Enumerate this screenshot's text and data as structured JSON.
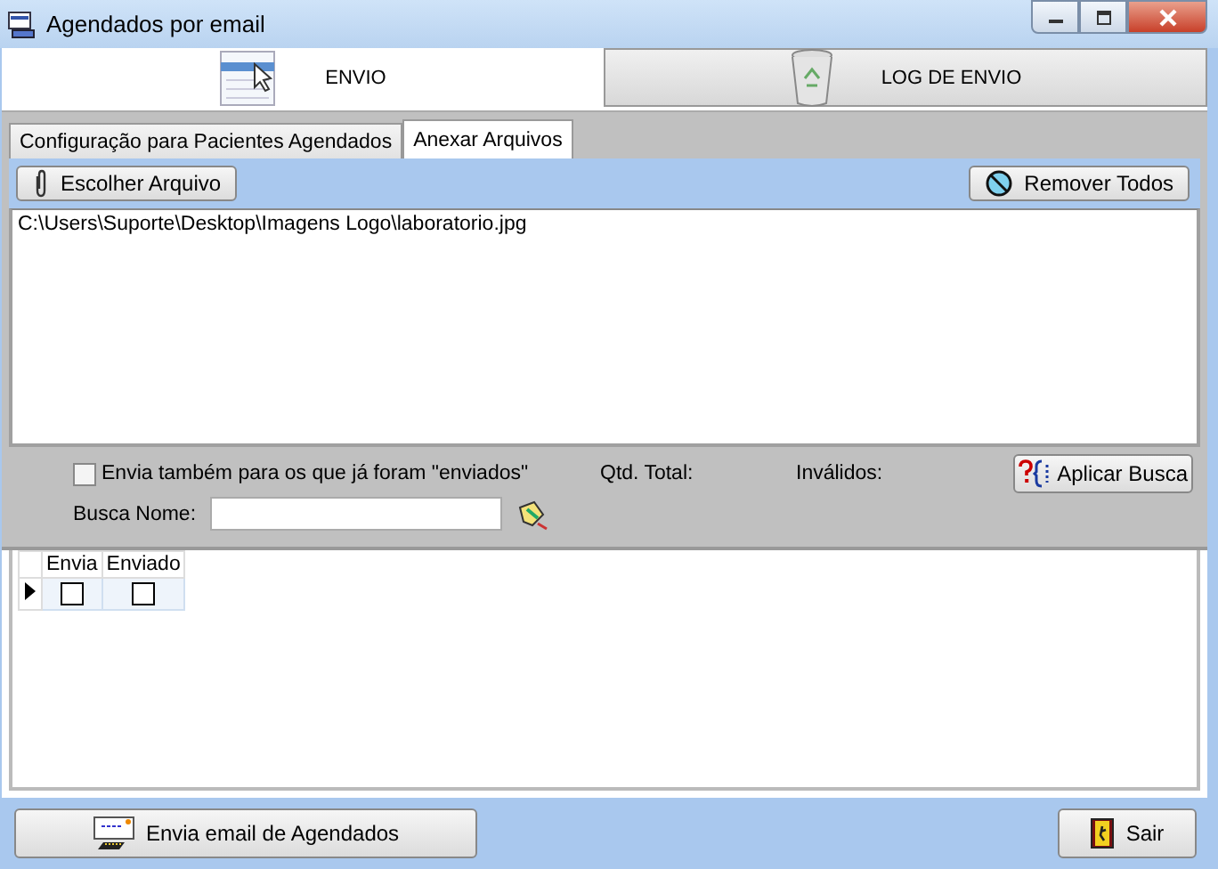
{
  "window": {
    "title": "Agendados por email"
  },
  "main_tabs": [
    {
      "label": "ENVIO",
      "selected": true,
      "kind": "form"
    },
    {
      "label": "LOG DE ENVIO",
      "selected": false,
      "kind": "trash"
    }
  ],
  "sub_tabs": [
    {
      "label": "Configuração para Pacientes Agendados",
      "selected": false
    },
    {
      "label": "Anexar Arquivos",
      "selected": true
    }
  ],
  "toolbar": {
    "choose_button": "Escolher Arquivo",
    "remove_button": "Remover Todos"
  },
  "files": [
    "C:\\Users\\Suporte\\Desktop\\Imagens Logo\\laboratorio.jpg"
  ],
  "filter": {
    "resend": {
      "label": "Envia também para os que já foram \"enviados\"",
      "checked": false
    },
    "total_label": "Qtd. Total:",
    "invalid_label": "Inválidos:",
    "search_label": "Busca Nome:",
    "apply_button": "Aplicar Busca"
  },
  "grid": {
    "columns": [
      "Envia",
      "Enviado"
    ],
    "rows": [
      {
        "envia": false,
        "enviado": false,
        "current": true
      }
    ]
  },
  "buttons": {
    "send": "Envia email de Agendados",
    "exit": "Sair"
  }
}
